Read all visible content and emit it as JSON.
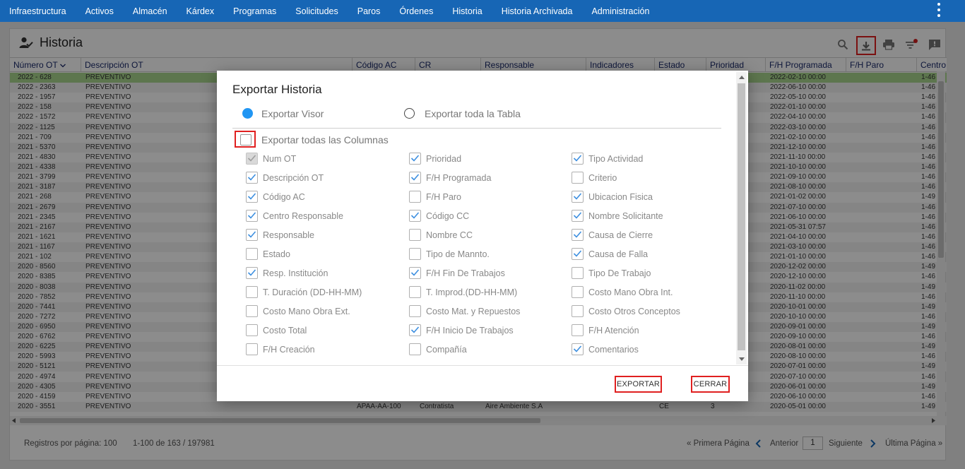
{
  "nav": {
    "items": [
      "Infraestructura",
      "Activos",
      "Almacén",
      "Kárdex",
      "Programas",
      "Solicitudes",
      "Paros",
      "Órdenes",
      "Historia",
      "Historia Archivada",
      "Administración"
    ]
  },
  "page": {
    "title": "Historia"
  },
  "table": {
    "columns": [
      "Número OT",
      "Descripción OT",
      "Código AC",
      "CR",
      "Responsable",
      "Indicadores",
      "Estado",
      "Prioridad",
      "F/H Programada",
      "F/H Paro",
      "Centro"
    ],
    "rows": [
      {
        "ot": "2022 - 628",
        "desc": "PREVENTIVO",
        "prog": "2022-02-10 00:00",
        "centro": "1-46",
        "selected": true
      },
      {
        "ot": "2022 - 2363",
        "desc": "PREVENTIVO",
        "prog": "2022-06-10 00:00",
        "centro": "1-46"
      },
      {
        "ot": "2022 - 1957",
        "desc": "PREVENTIVO",
        "prog": "2022-05-10 00:00",
        "centro": "1-46"
      },
      {
        "ot": "2022 - 158",
        "desc": "PREVENTIVO",
        "prog": "2022-01-10 00:00",
        "centro": "1-46"
      },
      {
        "ot": "2022 - 1572",
        "desc": "PREVENTIVO",
        "prog": "2022-04-10 00:00",
        "centro": "1-46"
      },
      {
        "ot": "2022 - 1125",
        "desc": "PREVENTIVO",
        "prog": "2022-03-10 00:00",
        "centro": "1-46"
      },
      {
        "ot": "2021 - 709",
        "desc": "PREVENTIVO",
        "prog": "2021-02-10 00:00",
        "centro": "1-46"
      },
      {
        "ot": "2021 - 5370",
        "desc": "PREVENTIVO",
        "prog": "2021-12-10 00:00",
        "centro": "1-46"
      },
      {
        "ot": "2021 - 4830",
        "desc": "PREVENTIVO",
        "prog": "2021-11-10 00:00",
        "centro": "1-46"
      },
      {
        "ot": "2021 - 4338",
        "desc": "PREVENTIVO",
        "prog": "2021-10-10 00:00",
        "centro": "1-46"
      },
      {
        "ot": "2021 - 3799",
        "desc": "PREVENTIVO",
        "prog": "2021-09-10 00:00",
        "centro": "1-46"
      },
      {
        "ot": "2021 - 3187",
        "desc": "PREVENTIVO",
        "prog": "2021-08-10 00:00",
        "centro": "1-46"
      },
      {
        "ot": "2021 - 268",
        "desc": "PREVENTIVO",
        "prog": "2021-01-02 00:00",
        "centro": "1-49"
      },
      {
        "ot": "2021 - 2679",
        "desc": "PREVENTIVO",
        "prog": "2021-07-10 00:00",
        "centro": "1-46"
      },
      {
        "ot": "2021 - 2345",
        "desc": "PREVENTIVO",
        "prog": "2021-06-10 00:00",
        "centro": "1-46"
      },
      {
        "ot": "2021 - 2167",
        "desc": "PREVENTIVO",
        "prog": "2021-05-31 07:57",
        "centro": "1-46"
      },
      {
        "ot": "2021 - 1621",
        "desc": "PREVENTIVO",
        "prog": "2021-04-10 00:00",
        "centro": "1-46"
      },
      {
        "ot": "2021 - 1167",
        "desc": "PREVENTIVO",
        "prog": "2021-03-10 00:00",
        "centro": "1-46"
      },
      {
        "ot": "2021 - 102",
        "desc": "PREVENTIVO",
        "prog": "2021-01-10 00:00",
        "centro": "1-46"
      },
      {
        "ot": "2020 - 8560",
        "desc": "PREVENTIVO",
        "prog": "2020-12-02 00:00",
        "centro": "1-49"
      },
      {
        "ot": "2020 - 8385",
        "desc": "PREVENTIVO",
        "prog": "2020-12-10 00:00",
        "centro": "1-46"
      },
      {
        "ot": "2020 - 8038",
        "desc": "PREVENTIVO",
        "prog": "2020-11-02 00:00",
        "centro": "1-49"
      },
      {
        "ot": "2020 - 7852",
        "desc": "PREVENTIVO",
        "prog": "2020-11-10 00:00",
        "centro": "1-46"
      },
      {
        "ot": "2020 - 7441",
        "desc": "PREVENTIVO",
        "prog": "2020-10-01 00:00",
        "centro": "1-49"
      },
      {
        "ot": "2020 - 7272",
        "desc": "PREVENTIVO",
        "prog": "2020-10-10 00:00",
        "centro": "1-46"
      },
      {
        "ot": "2020 - 6950",
        "desc": "PREVENTIVO",
        "prog": "2020-09-01 00:00",
        "centro": "1-49"
      },
      {
        "ot": "2020 - 6762",
        "desc": "PREVENTIVO",
        "prog": "2020-09-10 00:00",
        "centro": "1-46"
      },
      {
        "ot": "2020 - 6225",
        "desc": "PREVENTIVO",
        "prog": "2020-08-01 00:00",
        "centro": "1-49"
      },
      {
        "ot": "2020 - 5993",
        "desc": "PREVENTIVO",
        "prog": "2020-08-10 00:00",
        "centro": "1-46"
      },
      {
        "ot": "2020 - 5121",
        "desc": "PREVENTIVO",
        "prog": "2020-07-01 00:00",
        "centro": "1-49"
      },
      {
        "ot": "2020 - 4974",
        "desc": "PREVENTIVO",
        "prog": "2020-07-10 00:00",
        "centro": "1-46"
      },
      {
        "ot": "2020 - 4305",
        "desc": "PREVENTIVO",
        "prog": "2020-06-01 00:00",
        "centro": "1-49"
      },
      {
        "ot": "2020 - 4159",
        "desc": "PREVENTIVO",
        "prog": "2020-06-10 00:00",
        "centro": "1-46"
      },
      {
        "ot": "2020 - 3551",
        "desc": "PREVENTIVO",
        "ac": "APAA-AA-100",
        "cr": "Contratista",
        "resp": "Aire Ambiente S.A",
        "estado": "CE",
        "prioridad": "3",
        "prog": "2020-05-01 00:00",
        "centro": "1-49"
      }
    ]
  },
  "footer": {
    "per_page_label": "Registros por página: 100",
    "range": "1-100 de 163 / 197981",
    "first": "« Primera Página",
    "prev": "Anterior",
    "page_value": "1",
    "next": "Siguiente",
    "last": "Última Página »"
  },
  "modal": {
    "title": "Exportar Historia",
    "option_viewer": "Exportar Visor",
    "option_all": "Exportar toda la Tabla",
    "all_columns_label": "Exportar todas las Columnas",
    "columns": [
      {
        "label": "Num OT",
        "checked": true,
        "disabled": true
      },
      {
        "label": "Prioridad",
        "checked": true
      },
      {
        "label": "Tipo Actividad",
        "checked": true
      },
      {
        "label": "Descripción OT",
        "checked": true
      },
      {
        "label": "F/H Programada",
        "checked": true
      },
      {
        "label": "Criterio",
        "checked": false
      },
      {
        "label": "Código AC",
        "checked": true
      },
      {
        "label": "F/H Paro",
        "checked": false
      },
      {
        "label": "Ubicacion Fisica",
        "checked": true
      },
      {
        "label": "Centro Responsable",
        "checked": true
      },
      {
        "label": "Código CC",
        "checked": true
      },
      {
        "label": "Nombre Solicitante",
        "checked": true
      },
      {
        "label": "Responsable",
        "checked": true
      },
      {
        "label": "Nombre CC",
        "checked": false
      },
      {
        "label": "Causa de Cierre",
        "checked": true
      },
      {
        "label": "Estado",
        "checked": false
      },
      {
        "label": "Tipo de Mannto.",
        "checked": false
      },
      {
        "label": "Causa de Falla",
        "checked": true
      },
      {
        "label": "Resp. Institución",
        "checked": true
      },
      {
        "label": "F/H Fin De Trabajos",
        "checked": true
      },
      {
        "label": "Tipo De Trabajo",
        "checked": false
      },
      {
        "label": "T. Duración (DD-HH-MM)",
        "checked": false
      },
      {
        "label": "T. Improd.(DD-HH-MM)",
        "checked": false
      },
      {
        "label": "Costo Mano Obra Int.",
        "checked": false
      },
      {
        "label": "Costo Mano Obra Ext.",
        "checked": false
      },
      {
        "label": "Costo Mat. y Repuestos",
        "checked": false
      },
      {
        "label": "Costo Otros Conceptos",
        "checked": false
      },
      {
        "label": "Costo Total",
        "checked": false
      },
      {
        "label": "F/H Inicio De Trabajos",
        "checked": true
      },
      {
        "label": "F/H Atención",
        "checked": false
      },
      {
        "label": "F/H Creación",
        "checked": false
      },
      {
        "label": "Compañía",
        "checked": false
      },
      {
        "label": "Comentarios",
        "checked": true
      }
    ],
    "export_button": "EXPORTAR",
    "close_button": "CERRAR"
  },
  "colors": {
    "nav_bg": "#1766b5",
    "header_text": "#1b2a6b",
    "selected_row": "#a9d88e",
    "highlight": "#e02020",
    "radio_on": "#2196f3",
    "check": "#3d8fe0"
  }
}
